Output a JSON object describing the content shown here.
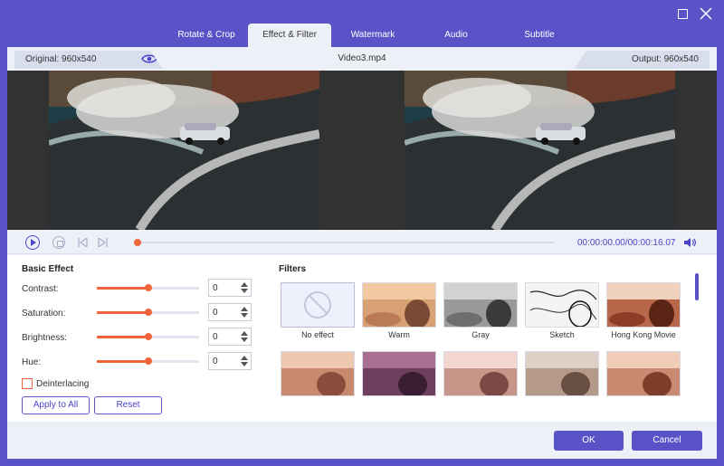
{
  "tabs": [
    {
      "label": "Rotate & Crop"
    },
    {
      "label": "Effect & Filter"
    },
    {
      "label": "Watermark"
    },
    {
      "label": "Audio"
    },
    {
      "label": "Subtitle"
    }
  ],
  "info": {
    "original": "Original: 960x540",
    "file_name": "Video3.mp4",
    "output": "Output: 960x540"
  },
  "player": {
    "current_time": "00:00:00.00",
    "separator": "/",
    "total_time": "00:00:16.07",
    "progress": 0
  },
  "basic_effect": {
    "title": "Basic Effect",
    "rows": [
      {
        "label": "Contrast:",
        "value": "0",
        "level": 0.5
      },
      {
        "label": "Saturation:",
        "value": "0",
        "level": 0.5
      },
      {
        "label": "Brightness:",
        "value": "0",
        "level": 0.5
      },
      {
        "label": "Hue:",
        "value": "0",
        "level": 0.5
      }
    ],
    "deinterlacing": "Deinterlacing",
    "apply_all": "Apply to All",
    "reset": "Reset"
  },
  "filters": {
    "title": "Filters",
    "items": [
      {
        "name": "No effect"
      },
      {
        "name": "Warm"
      },
      {
        "name": "Gray"
      },
      {
        "name": "Sketch"
      },
      {
        "name": "Hong Kong Movie"
      }
    ]
  },
  "footer": {
    "ok": "OK",
    "cancel": "Cancel"
  },
  "colors": {
    "accent": "#5a53c8",
    "slider": "#f0643c"
  }
}
